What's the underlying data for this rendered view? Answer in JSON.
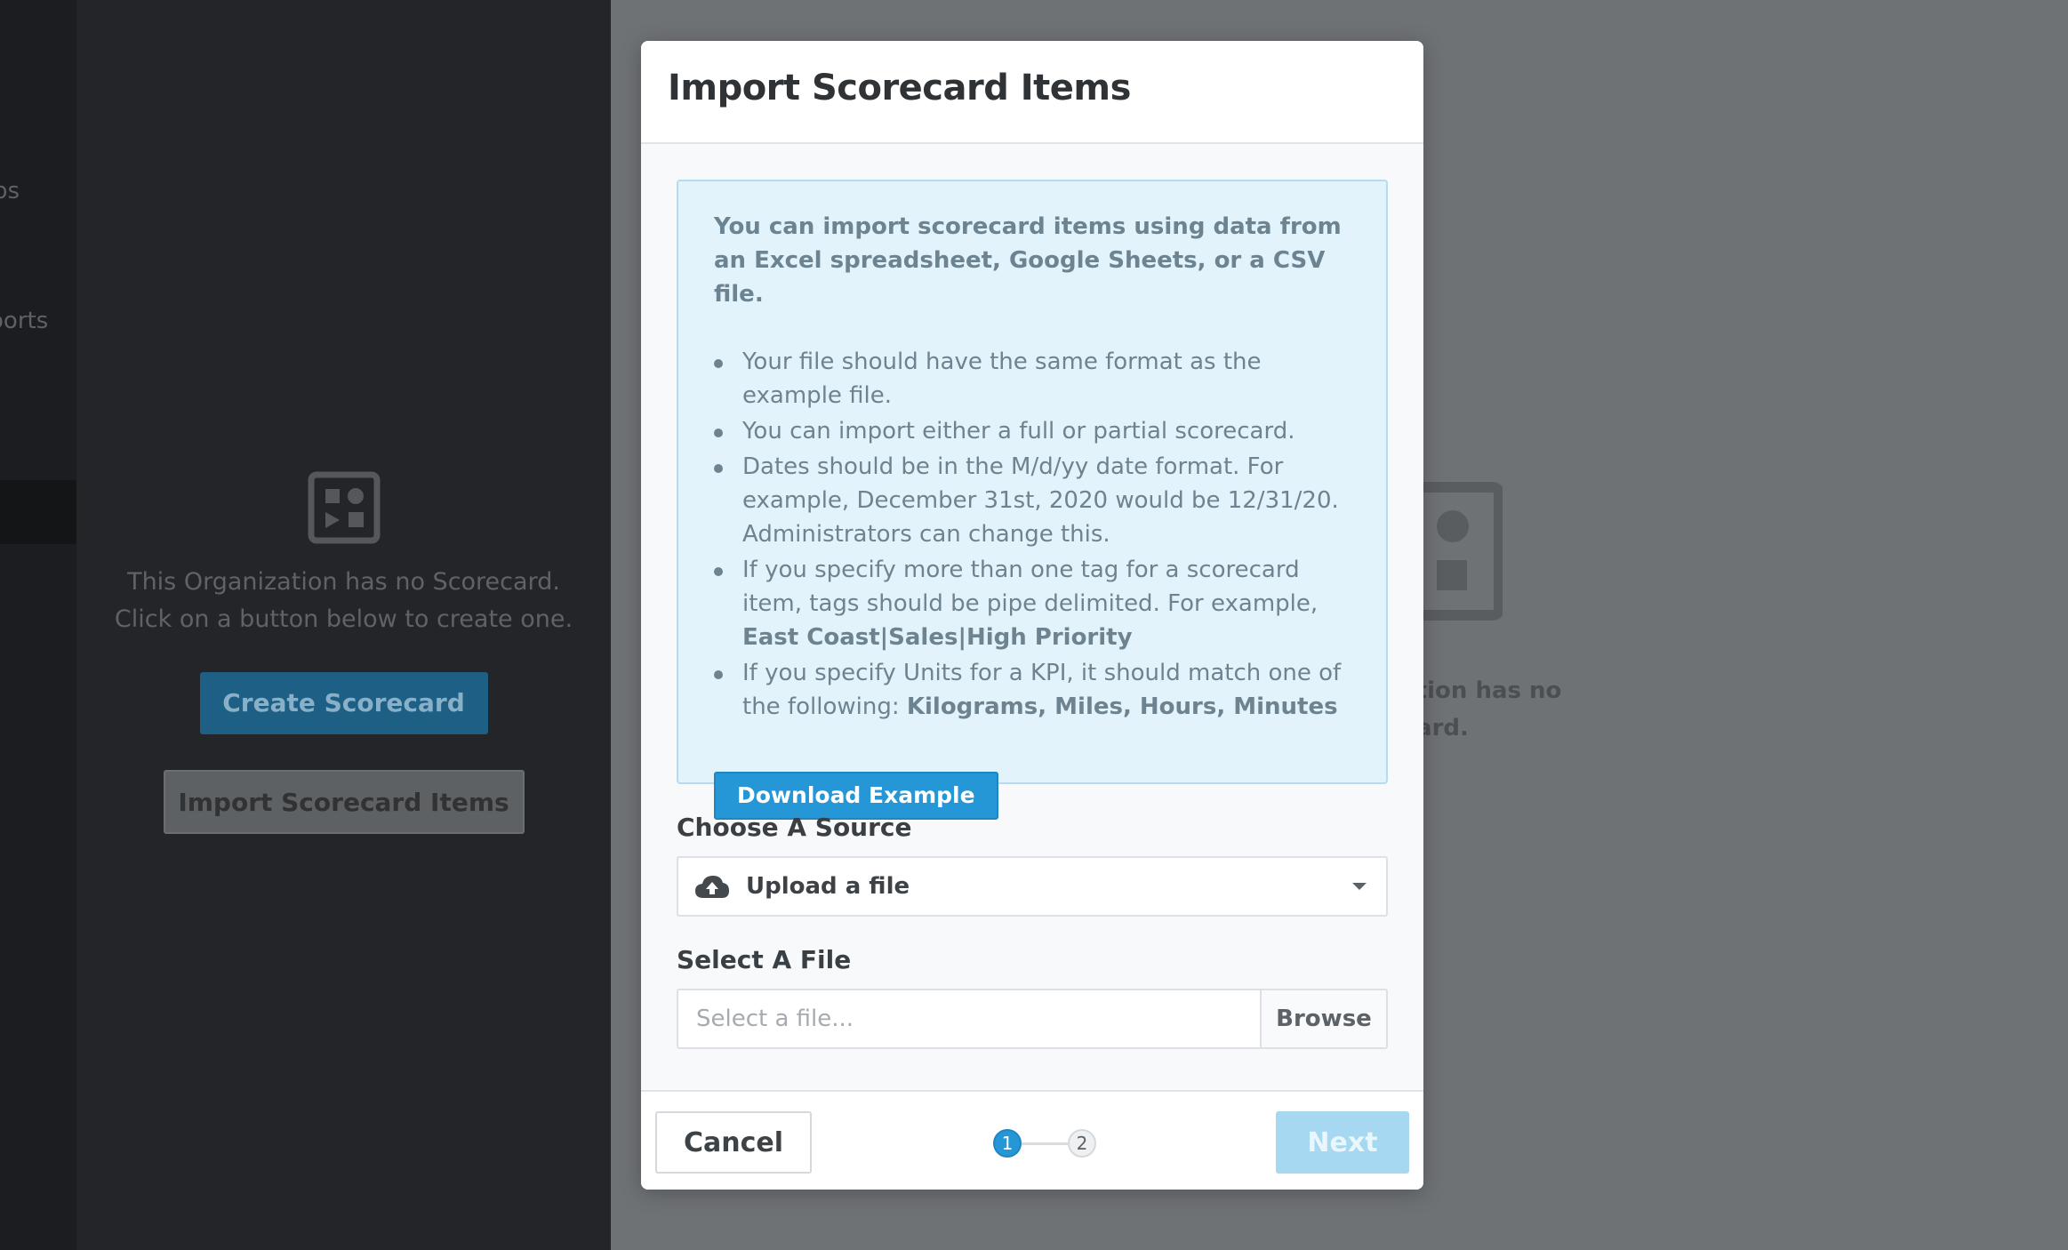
{
  "background": {
    "nav_items": [
      "ps",
      "oorts"
    ],
    "empty_state": {
      "line1": "This Organization has no Scorecard.",
      "line2": "Click on a button below to create one.",
      "create_button": "Create Scorecard",
      "import_button": "Import Scorecard Items"
    },
    "right_panel": {
      "line1": "zation has no",
      "line2": "ecard."
    }
  },
  "modal": {
    "title": "Import Scorecard Items",
    "info": {
      "intro": "You can import scorecard items using data from an Excel spreadsheet, Google Sheets, or a CSV file.",
      "bullets": {
        "b1": "Your file should have the same format as the example file.",
        "b2": "You can import either a full or partial scorecard.",
        "b3": "Dates should be in the M/d/yy date format. For example, December 31st, 2020 would be 12/31/20. Administrators can change this.",
        "b4_text": "If you specify more than one tag for a scorecard item, tags should be pipe delimited. For example, ",
        "b4_bold": "East Coast|Sales|High Priority",
        "b5_text": "If you specify Units for a KPI, it should match one of the following: ",
        "b5_bold": "Kilograms, Miles, Hours, Minutes"
      },
      "download_button": "Download Example"
    },
    "source": {
      "label": "Choose A Source",
      "selected": "Upload a file",
      "icon": "cloud-upload-icon"
    },
    "file": {
      "label": "Select A File",
      "placeholder": "Select a file...",
      "value": "",
      "browse_button": "Browse"
    },
    "footer": {
      "cancel_button": "Cancel",
      "steps": [
        "1",
        "2"
      ],
      "current_step": 1,
      "next_button": "Next"
    }
  },
  "colors": {
    "accent": "#2596d6",
    "next_disabled": "#a7d8f1",
    "info_bg": "#e3f3fb",
    "overlay": "#6f7275"
  }
}
